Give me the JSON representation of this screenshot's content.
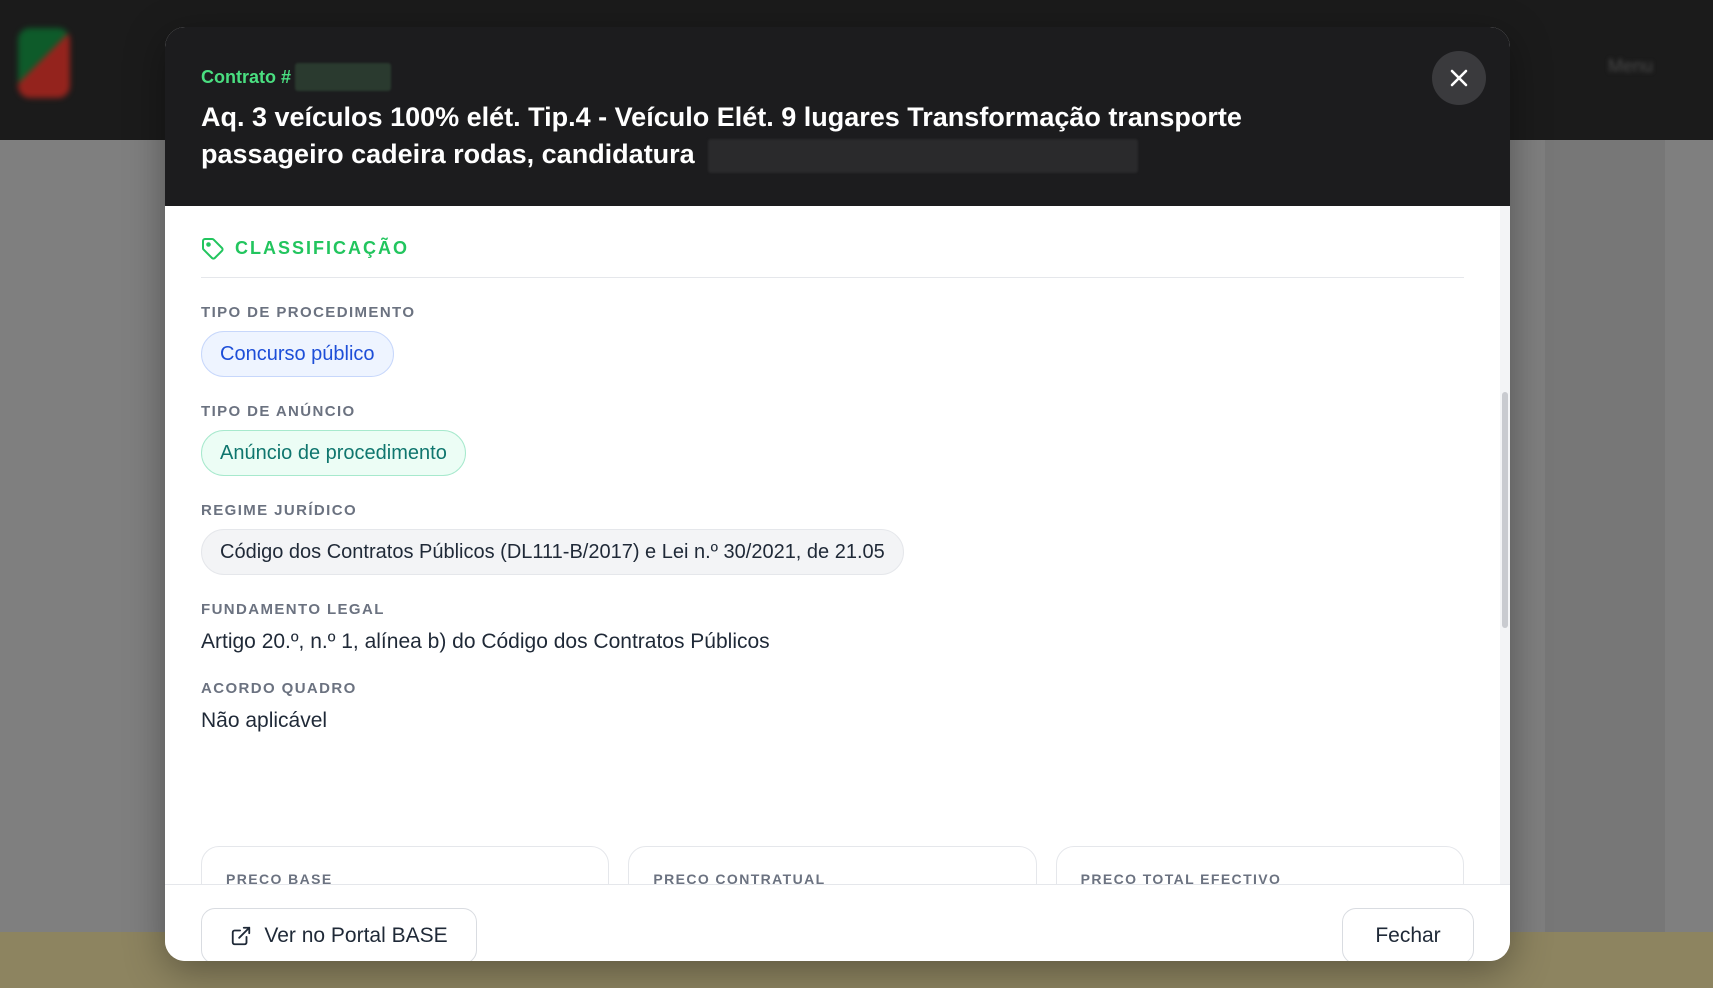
{
  "modal": {
    "contract_label": "Contrato #",
    "title": "Aq. 3 veículos 100% elét. Tip.4 - Veículo Elét. 9 lugares Transformação transporte passageiro cadeira rodas, candidatura",
    "close_icon": "close-icon"
  },
  "classification": {
    "section_title": "CLASSIFICAÇÃO",
    "section_icon": "tag-icon",
    "fields": {
      "tipo_procedimento": {
        "label": "TIPO DE PROCEDIMENTO",
        "value": "Concurso público"
      },
      "tipo_anuncio": {
        "label": "TIPO DE ANÚNCIO",
        "value": "Anúncio de procedimento"
      },
      "regime_juridico": {
        "label": "REGIME JURÍDICO",
        "value": "Código dos Contratos Públicos (DL111-B/2017) e Lei n.º 30/2021, de 21.05"
      },
      "fundamento_legal": {
        "label": "FUNDAMENTO LEGAL",
        "value": "Artigo 20.º, n.º 1, alínea b) do Código dos Contratos Públicos"
      },
      "acordo_quadro": {
        "label": "ACORDO QUADRO",
        "value": "Não aplicável"
      }
    }
  },
  "prices": [
    {
      "label": "PREÇO BASE"
    },
    {
      "label": "PREÇO CONTRATUAL"
    },
    {
      "label": "PREÇO TOTAL EFECTIVO"
    }
  ],
  "footer": {
    "portal_label": "Ver no Portal BASE",
    "portal_icon": "external-link-icon",
    "close_label": "Fechar"
  },
  "background": {
    "menu_label": "Menu"
  },
  "colors": {
    "accent": "#22c55e",
    "header_bg": "#1c1c1e",
    "pill_blue_text": "#1d4ed8",
    "pill_green_text": "#0f766e"
  }
}
